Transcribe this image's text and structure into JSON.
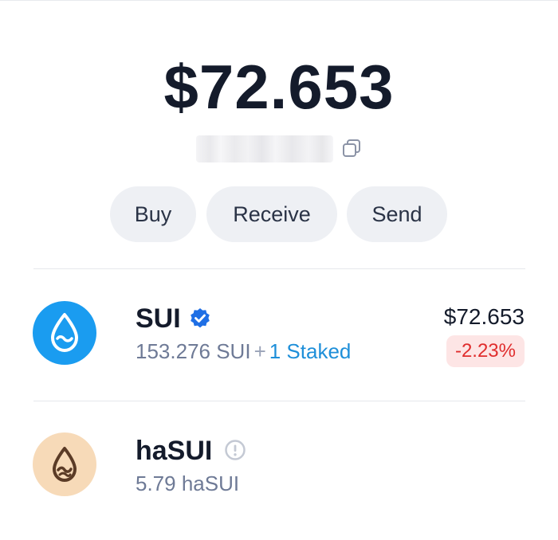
{
  "wallet": {
    "balance": "$72.653",
    "address_masked": "0x0000000000000000"
  },
  "actions": {
    "buy_label": "Buy",
    "receive_label": "Receive",
    "send_label": "Send"
  },
  "tokens": [
    {
      "name": "SUI",
      "status_icon": "verified-badge-icon",
      "amount": "153.276 SUI",
      "separator": "+",
      "staked": "1 Staked",
      "value": "$72.653",
      "change": "-2.23%",
      "logo_color": "#1a9cf0"
    },
    {
      "name": "haSUI",
      "status_icon": "info-warning-icon",
      "amount": "5.79 haSUI",
      "logo_color": "#f7dab8"
    }
  ],
  "colors": {
    "primary_text": "#141b2b",
    "secondary_text": "#6e7a96",
    "accent": "#1e8fd9",
    "negative": "#e02d2d",
    "negative_bg": "#fde5e5",
    "button_bg": "#eef0f4"
  }
}
